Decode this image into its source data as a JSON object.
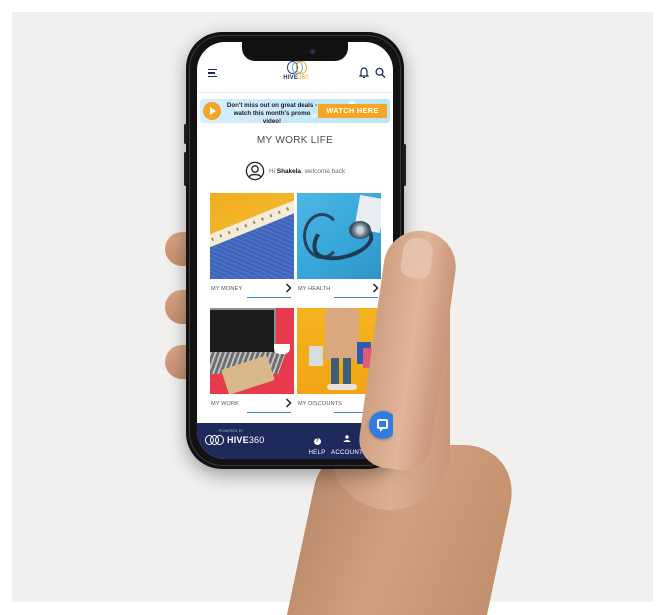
{
  "header": {
    "logo_text": "HIVE",
    "logo_text_accent": "360"
  },
  "promo": {
    "text": "Don't miss out on great deals - watch this month's promo video!",
    "button_label": "WATCH HERE"
  },
  "main": {
    "title": "MY WORK LIFE",
    "greeting_prefix": "Hi",
    "user_name": "Shakela",
    "greeting_suffix": "welcome back"
  },
  "cards": [
    {
      "label": "MY MONEY",
      "image": "money-image"
    },
    {
      "label": "MY HEALTH",
      "image": "health-image"
    },
    {
      "label": "MY WORK",
      "image": "work-image"
    },
    {
      "label": "MY DISCOUNTS",
      "image": "discounts-image"
    }
  ],
  "bottom_bar": {
    "powered_by": "POWERED BY",
    "brand": "HIVE",
    "brand_number": "360",
    "help_label": "HELP",
    "account_label": "ACCOUNT"
  },
  "icons": {
    "menu": "menu-icon",
    "notifications": "bell-icon",
    "search": "search-icon",
    "avatar": "user-circle-icon",
    "play": "play-icon",
    "chevron": "chevron-right-icon",
    "help": "question-icon",
    "account": "person-icon",
    "chat": "chat-icon"
  },
  "colors": {
    "navy": "#1f2a5c",
    "accent_orange": "#f5a623",
    "link_blue": "#3a8cc9",
    "fab_blue": "#2f7de1"
  }
}
